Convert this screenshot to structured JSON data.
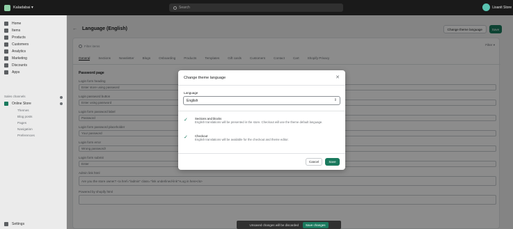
{
  "topbar": {
    "store_name": "Kaladabai ▾",
    "search_placeholder": "Search",
    "account_name": "Lisanit Store"
  },
  "sidebar": {
    "items": [
      {
        "label": "Home",
        "icon": "home-icon"
      },
      {
        "label": "Items",
        "icon": "inbox-icon"
      },
      {
        "label": "Products",
        "icon": "tag-icon"
      },
      {
        "label": "Customers",
        "icon": "person-icon"
      },
      {
        "label": "Analytics",
        "icon": "chart-icon"
      },
      {
        "label": "Marketing",
        "icon": "megaphone-icon"
      },
      {
        "label": "Discounts",
        "icon": "discount-icon"
      },
      {
        "label": "Apps",
        "icon": "apps-icon"
      }
    ],
    "sales_channels_label": "Sales channels",
    "online_store": "Online Store",
    "sub_items": [
      "Themes",
      "Blog posts",
      "Pages",
      "Navigation",
      "Preferences"
    ],
    "settings_label": "Settings"
  },
  "header": {
    "title": "Language (English)",
    "change_button": "Change theme language",
    "save_button": "Save"
  },
  "content": {
    "filter_placeholder": "Filter items",
    "filter_dropdown": "Filter ▾",
    "tabs": [
      "General",
      "Sections",
      "Newsletter",
      "Blogs",
      "Onboarding",
      "Products",
      "Templates",
      "Gift cards",
      "Customers",
      "Contact",
      "Cart",
      "Shopify Privacy"
    ],
    "section_title": "Password page",
    "fields": [
      {
        "label": "Login form heading",
        "value": "Enter store using password"
      },
      {
        "label": "Login password button",
        "value": "Enter using password"
      },
      {
        "label": "Login form password label",
        "value": "Password"
      },
      {
        "label": "Login form password placeholder",
        "value": "Your password"
      },
      {
        "label": "Login form error",
        "value": "Wrong password!"
      },
      {
        "label": "Login form submit",
        "value": "Enter"
      },
      {
        "label": "Admin link html",
        "value": "Are you the store owner? <a href=\"/admin\" class=\"link underlined-link\">Log in here</a>"
      },
      {
        "label": "Powered by shopify html",
        "value": ""
      }
    ]
  },
  "modal": {
    "title": "Change theme language",
    "language_label": "Language",
    "selected_language": "English",
    "items": [
      {
        "title": "Sections and blocks",
        "text": "English translations will be presented in the store. Checkout will use the theme default language."
      },
      {
        "title": "Checkout",
        "text": "English translations will be available for the checkout and theme editor."
      }
    ],
    "cancel": "Cancel",
    "save": "Save"
  },
  "toast": {
    "text": "Unsaved changes will be discarded",
    "button": "Save changes"
  },
  "colors": {
    "accent": "#1a7a5e",
    "topbar": "#1a1a1a"
  }
}
